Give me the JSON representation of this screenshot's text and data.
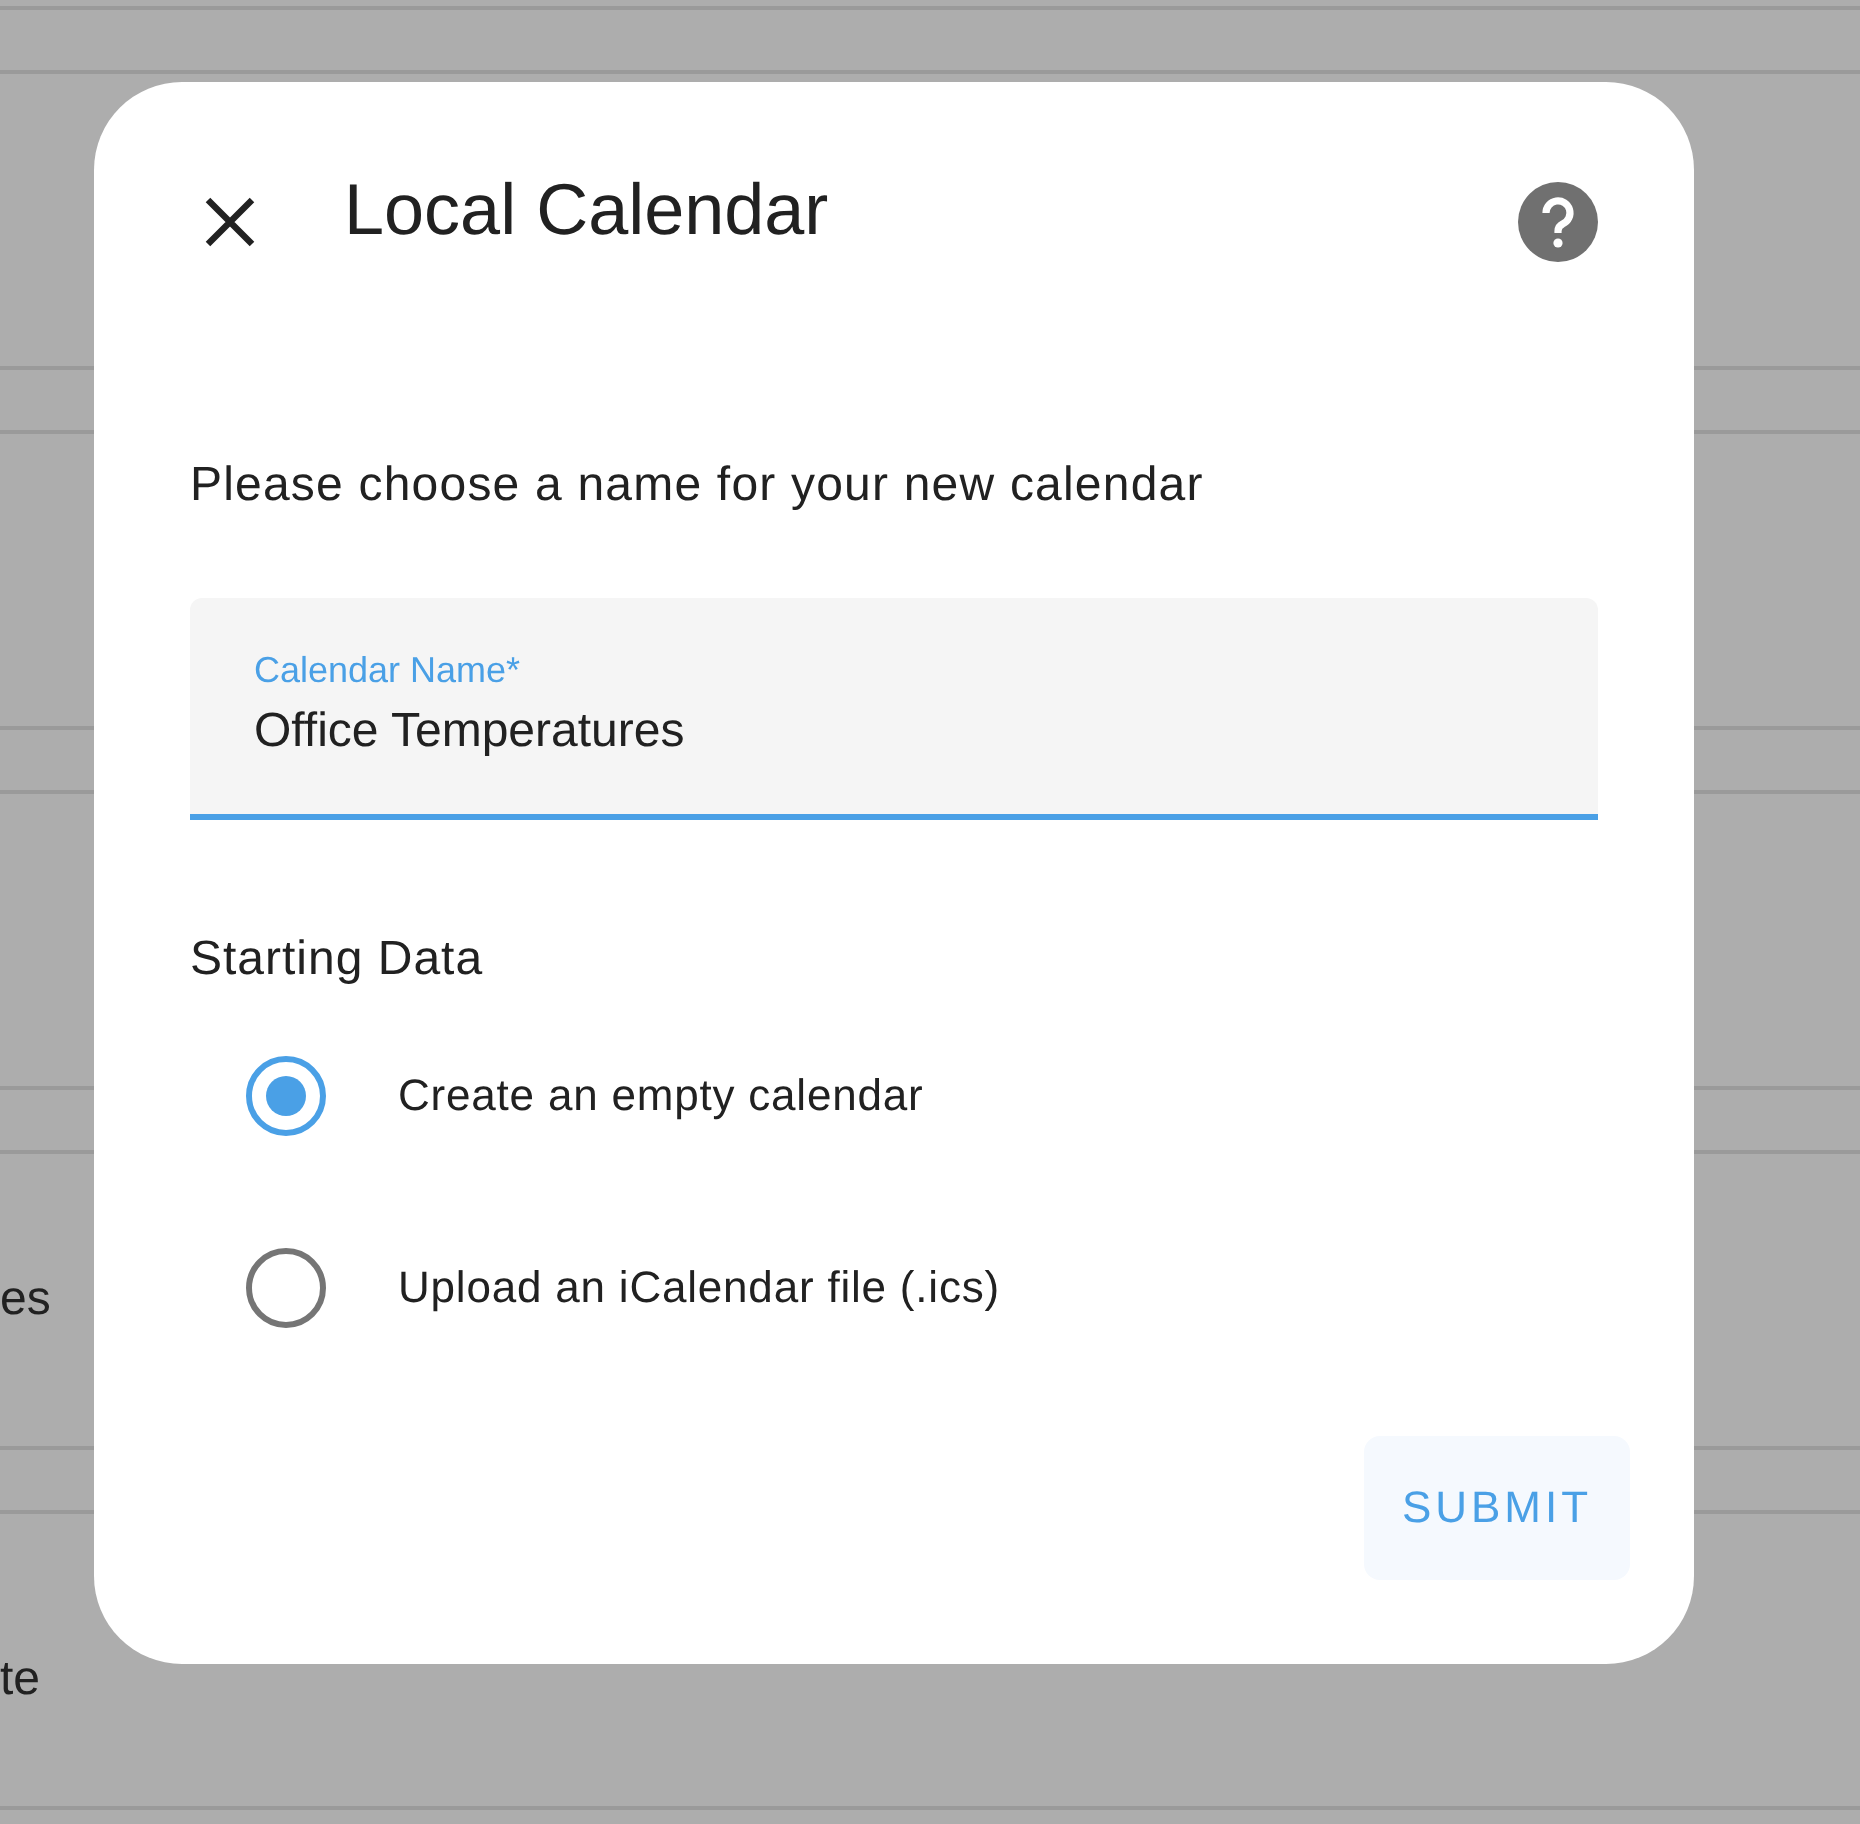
{
  "background_rows": [
    {
      "label": "es"
    },
    {
      "label": "te"
    }
  ],
  "dialog": {
    "title": "Local Calendar",
    "prompt": "Please choose a name for your new calendar",
    "field": {
      "label": "Calendar Name*",
      "value": "Office Temperatures",
      "focused": true
    },
    "section_title": "Starting Data",
    "options": [
      {
        "label": "Create an empty calendar",
        "selected": true
      },
      {
        "label": "Upload an iCalendar file (.ics)",
        "selected": false
      }
    ],
    "submit": "SUBMIT"
  }
}
